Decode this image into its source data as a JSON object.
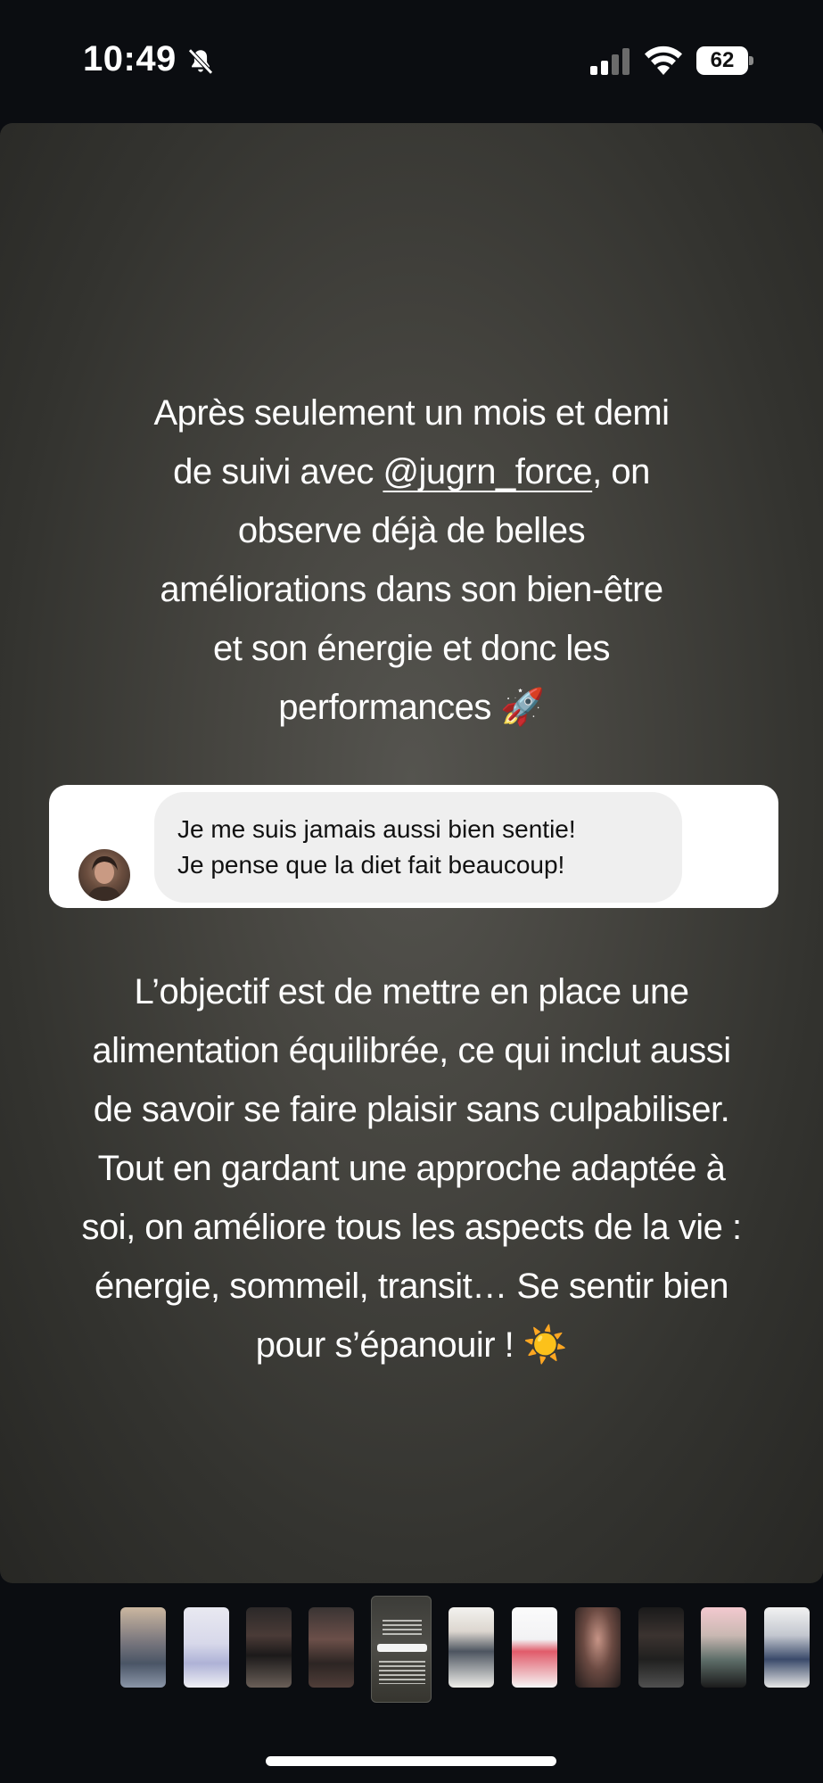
{
  "status_bar": {
    "time": "10:49",
    "battery": "62",
    "icons": [
      "bell-off-icon",
      "signal-icon",
      "wifi-icon",
      "battery-icon"
    ]
  },
  "story": {
    "text_1": {
      "lines": [
        "Après seulement un mois et demi",
        "de suivi avec ",
        "observe déjà de belles",
        "améliorations dans son bien-être",
        "et son énergie et donc les",
        "performances 🚀"
      ],
      "mention": "@jugrn_force",
      "after_mention": ", on"
    },
    "reply": {
      "line_1": "Je me suis jamais aussi bien sentie!",
      "line_2": "Je pense que la diet fait beaucoup!"
    },
    "text_2": {
      "lines": [
        "L’objectif est de mettre en place une",
        "alimentation équilibrée, ce qui inclut aussi",
        "de savoir se faire plaisir sans culpabiliser.",
        "Tout en gardant une approche adaptée à",
        "soi, on améliore tous les aspects de la vie :",
        "énergie, sommeil, transit… Se sentir bien",
        "pour s’épanouir ! ☀️"
      ]
    }
  },
  "thumbnails": {
    "count": 11,
    "selected_index": 4
  },
  "colors": {
    "background": "#0b0d11",
    "card_center": "#55544f",
    "card_edge": "#272724",
    "text": "#ffffff",
    "bubble": "#efefef"
  }
}
